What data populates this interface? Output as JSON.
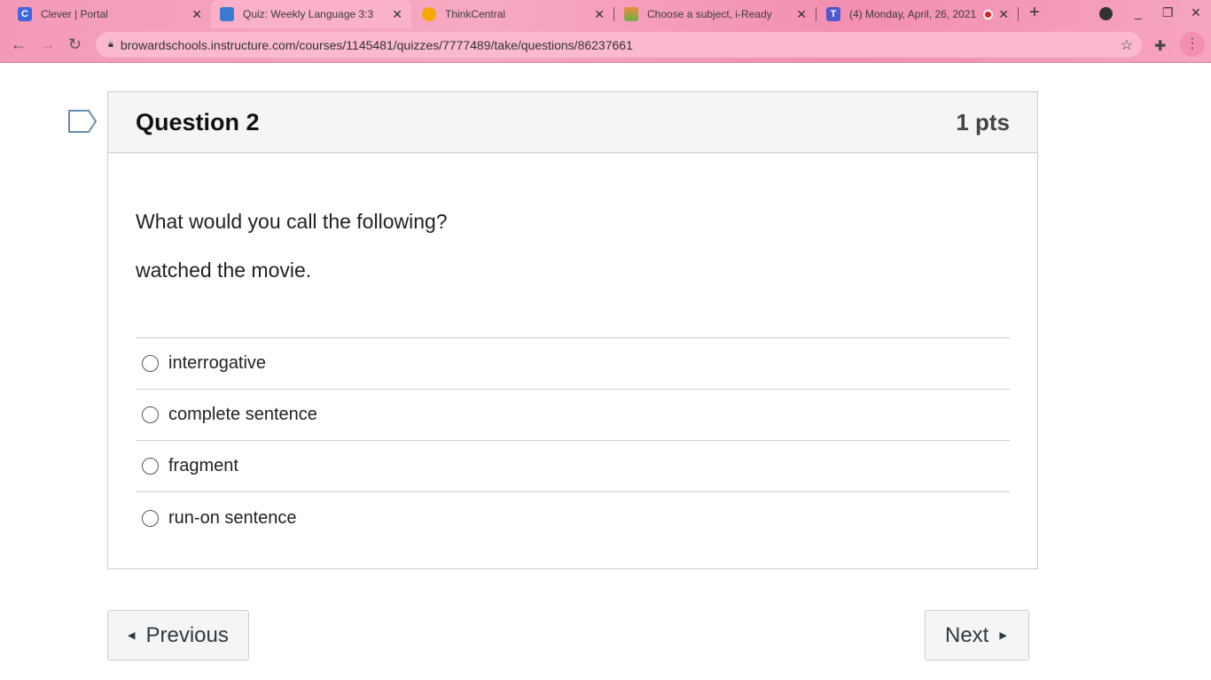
{
  "browser": {
    "tabs": [
      {
        "title": "Clever | Portal",
        "icon": "C",
        "color": "#4066e0"
      },
      {
        "title": "Quiz: Weekly Language 3:3",
        "icon": "",
        "color": "#3a7bd5",
        "active": true
      },
      {
        "title": "ThinkCentral",
        "icon": "",
        "color": "#f5a800"
      },
      {
        "title": "Choose a subject, i-Ready",
        "icon": "",
        "color": "#66b24a"
      },
      {
        "title": "(4) Monday, April, 26, 2021",
        "icon": "T",
        "color": "#5059c9"
      }
    ],
    "url": "browardschools.instructure.com/courses/1145481/quizzes/7777489/take/questions/86237661"
  },
  "question": {
    "title": "Question 2",
    "points": "1 pts",
    "prompt": "What would you call the following?",
    "text": "watched the movie.",
    "answers": [
      "interrogative",
      "complete sentence",
      "fragment",
      "run-on sentence"
    ]
  },
  "nav": {
    "previous": "Previous",
    "next": "Next"
  }
}
